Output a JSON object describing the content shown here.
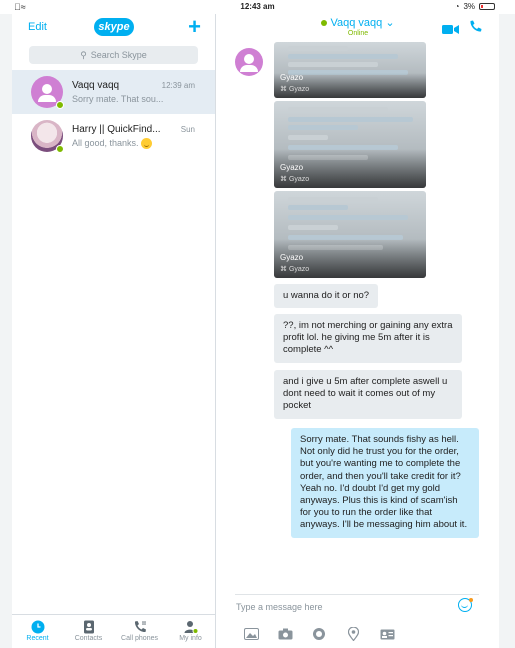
{
  "status_bar": {
    "time": "12:43 am",
    "battery": "3%",
    "carrier_icon": "apple-icon",
    "wifi_icon": "wifi-icon"
  },
  "left": {
    "edit_label": "Edit",
    "logo_text": "skype",
    "search_placeholder": "Search Skype",
    "conversations": [
      {
        "name": "Vaqq vaqq",
        "preview": "Sorry mate. That sou...",
        "time": "12:39 am",
        "status": "online"
      },
      {
        "name": "Harry || QuickFind...",
        "preview": "All good, thanks.",
        "time": "Sun",
        "status": "online"
      }
    ],
    "tabs": [
      {
        "label": "Recent",
        "icon": "clock-icon",
        "active": true
      },
      {
        "label": "Contacts",
        "icon": "contacts-book-icon",
        "active": false
      },
      {
        "label": "Call phones",
        "icon": "phone-dialpad-icon",
        "active": false
      },
      {
        "label": "My info",
        "icon": "user-icon",
        "active": false
      }
    ]
  },
  "chat": {
    "title": "Vaqq vaqq",
    "status": "Online",
    "attachments": [
      {
        "brand": "Gyazo",
        "caption": "Gyazo"
      },
      {
        "brand": "Gyazo",
        "caption": "Gyazo"
      },
      {
        "brand": "Gyazo",
        "caption": "Gyazo"
      }
    ],
    "messages": [
      {
        "from": "them",
        "text": "u wanna do it or no?"
      },
      {
        "from": "them",
        "text": "??, im not merching or gaining any extra profit lol. he giving me 5m after it is complete ^^"
      },
      {
        "from": "them",
        "text": "and i give u 5m after complete aswell u dont need to wait it comes out of my pocket"
      },
      {
        "from": "me",
        "text": "Sorry mate. That sounds fishy as hell. Not only did he trust you for the order, but you're wanting me to complete the order, and then you'll take credit for it? Yeah no. I'd doubt I'd get my gold anyways. Plus this is kind of scam'ish for you to run the order like that anyways. I'll be messaging him about it."
      }
    ],
    "composer_placeholder": "Type a message here"
  },
  "colors": {
    "accent": "#00aff0",
    "presence": "#7fba00",
    "outgoing_bubble": "#c7ebfb",
    "incoming_bubble": "#e8ecef",
    "avatar": "#cf7fd3"
  }
}
